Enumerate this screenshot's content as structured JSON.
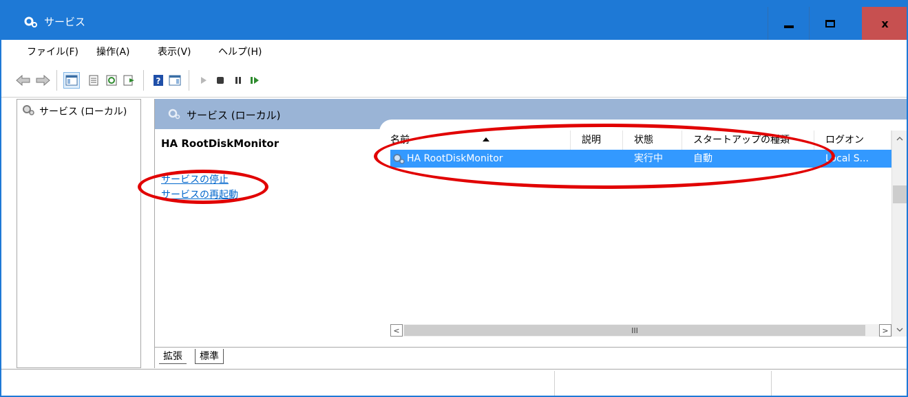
{
  "window": {
    "title": "サービス",
    "icon": "gear-icon",
    "accent_color": "#1e79d6",
    "close_color": "#c75050",
    "min_label": "",
    "max_label": "",
    "close_label": "x"
  },
  "menu": {
    "items": [
      "ファイル(F)",
      "操作(A)",
      "表示(V)",
      "ヘルプ(H)"
    ]
  },
  "toolbar": {
    "icons": [
      "back-arrow-icon",
      "forward-arrow-icon",
      "show-hide-tree-icon",
      "properties-icon",
      "refresh-icon",
      "export-list-icon",
      "help-icon",
      "action-pane-icon",
      "start-icon",
      "stop-icon",
      "pause-icon",
      "restart-icon"
    ]
  },
  "tree": {
    "root_label": "サービス (ローカル)"
  },
  "right_pane": {
    "header_title": "サービス (ローカル)",
    "header_color": "#9ab4d6"
  },
  "description": {
    "service_name": "HA RootDiskMonitor",
    "stop_link": "サービスの停止",
    "restart_link": "サービスの再起動"
  },
  "services_table": {
    "columns": [
      "名前",
      "説明",
      "状態",
      "スタートアップの種類",
      "ログオン"
    ],
    "sorted_column": "名前",
    "rows": [
      {
        "name": "HA RootDiskMonitor",
        "description": "",
        "status": "実行中",
        "startup_type": "自動",
        "logon": "Local S...",
        "selected": true
      }
    ],
    "selection_color": "#3399ff",
    "scroll_left": "<",
    "scroll_right": ">",
    "scroll_thumb": "III",
    "scroll_up": "^",
    "scroll_down": "v"
  },
  "tabs": [
    "拡張",
    "標準"
  ],
  "active_tab": "拡張",
  "annotation_color": "#e10000"
}
